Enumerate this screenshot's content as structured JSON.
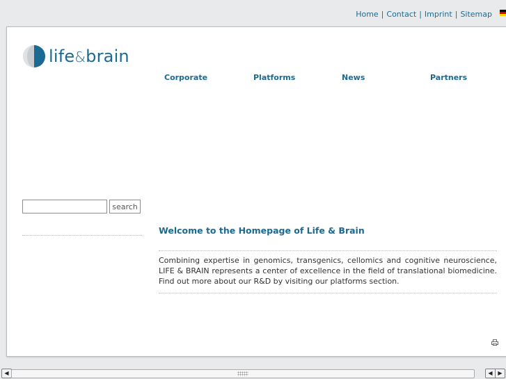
{
  "topnav": {
    "items": [
      "Home",
      "Contact",
      "Imprint",
      "Sitemap"
    ],
    "separator": "|"
  },
  "language_flag": "german-flag-icon",
  "logo": {
    "part1": "life",
    "amp": "&",
    "part2": "brain"
  },
  "mainnav": {
    "items": [
      "Corporate",
      "Platforms",
      "News",
      "Partners"
    ]
  },
  "search": {
    "value": "",
    "button_label": "search"
  },
  "content": {
    "title": "Welcome to the Homepage of Life & Brain",
    "intro": "Combining expertise in genomics, transgenics, cellomics and cognitive neuroscience, LIFE & BRAIN represents a center of excellence in the field of translational biomedicine. Find out more about our R&D by visiting our platforms section."
  },
  "colors": {
    "accent": "#1a6a93",
    "background": "#e9eaeb",
    "panel": "#ffffff"
  },
  "icons": {
    "print": "print-icon"
  }
}
